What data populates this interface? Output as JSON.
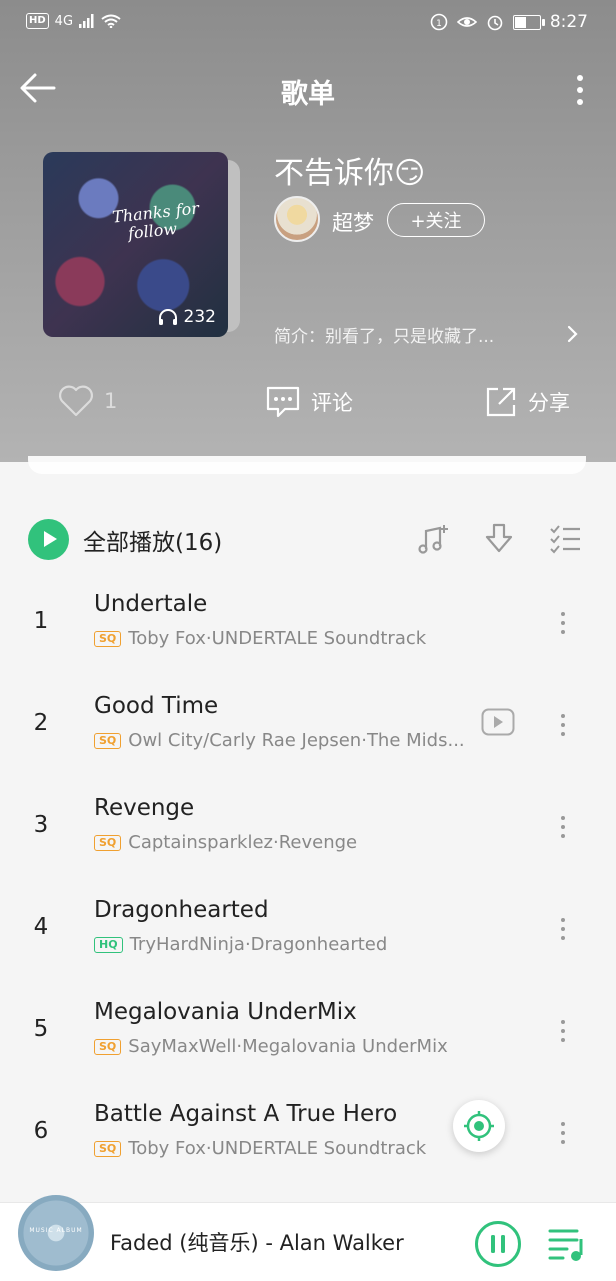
{
  "status_bar": {
    "hd": "HD",
    "network": "4G",
    "time": "8:27"
  },
  "nav": {
    "title": "歌单",
    "back_icon": "arrow-left-icon",
    "more_icon": "more-vertical-icon"
  },
  "playlist": {
    "name": "不告诉你",
    "emoji": "😏",
    "cover_text_line1": "Thanks for",
    "cover_text_line2": "follow",
    "play_count": "232",
    "creator": "超梦",
    "follow_label": "+关注",
    "description": "简介：别看了，只是收藏了..."
  },
  "actions": {
    "like_count": "1",
    "comment_label": "评论",
    "share_label": "分享"
  },
  "list_header": {
    "play_all_label": "全部播放(16)"
  },
  "songs": [
    {
      "index": "1",
      "title": "Undertale",
      "quality": "SQ",
      "meta": "Toby Fox·UNDERTALE Soundtrack",
      "has_mv": false
    },
    {
      "index": "2",
      "title": "Good Time",
      "quality": "SQ",
      "meta": "Owl City/Carly Rae Jepsen·The Mids...",
      "has_mv": true
    },
    {
      "index": "3",
      "title": "Revenge",
      "quality": "SQ",
      "meta": "Captainsparklez·Revenge",
      "has_mv": false
    },
    {
      "index": "4",
      "title": "Dragonhearted",
      "quality": "HQ",
      "meta": "TryHardNinja·Dragonhearted",
      "has_mv": false
    },
    {
      "index": "5",
      "title": "Megalovania UnderMix",
      "quality": "SQ",
      "meta": "SayMaxWell·Megalovania UnderMix",
      "has_mv": false
    },
    {
      "index": "6",
      "title": "Battle Against A True Hero",
      "quality": "SQ",
      "meta": "Toby Fox·UNDERTALE Soundtrack",
      "has_mv": false
    }
  ],
  "player": {
    "album_art_text": "MUSIC ALBUM",
    "now_playing": "Faded (纯音乐) - Alan Walker"
  },
  "colors": {
    "accent": "#31c27c",
    "sq_badge": "#f0a030",
    "header_gray": "#9e9e9e"
  }
}
